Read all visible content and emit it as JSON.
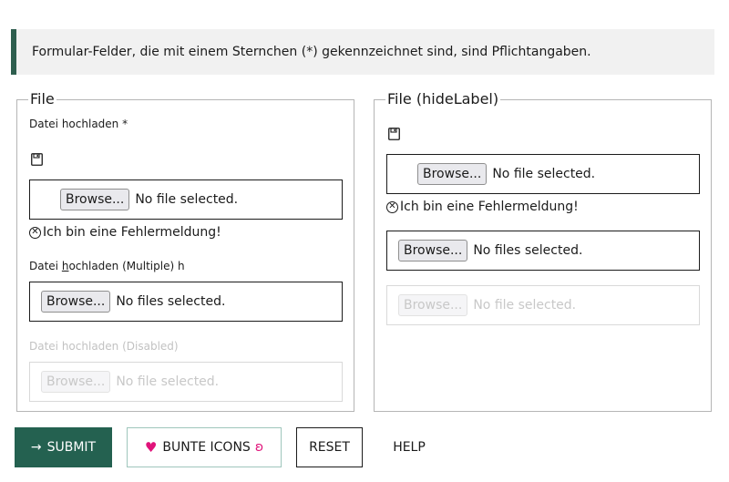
{
  "notice": {
    "text": "Formular-Felder, die mit einem Sternchen (*) gekennzeichnet sind, sind Pflichtangaben."
  },
  "fieldset_left": {
    "legend": "File",
    "field1": {
      "label": "Datei hochladen *",
      "icon": "floppy-disk-icon",
      "button": "Browse...",
      "status": "No file selected.",
      "error": "Ich bin eine Fehlermeldung!"
    },
    "field2": {
      "label_prefix": "Datei ",
      "label_underlined": "h",
      "label_suffix": "ochladen (Multiple) h",
      "button": "Browse...",
      "status": "No files selected."
    },
    "field3": {
      "label": "Datei hochladen (Disabled)",
      "button": "Browse...",
      "status": "No file selected."
    }
  },
  "fieldset_right": {
    "legend": "File (hideLabel)",
    "field1": {
      "icon": "floppy-disk-icon",
      "button": "Browse...",
      "status": "No file selected.",
      "error": "Ich bin eine Fehlermeldung!"
    },
    "field2": {
      "button": "Browse...",
      "status": "No files selected."
    },
    "field3": {
      "button": "Browse...",
      "status": "No file selected."
    }
  },
  "actions": {
    "submit": "SUBMIT",
    "bunte": "BUNTE ICONS",
    "reset": "RESET",
    "help": "HELP"
  },
  "colors": {
    "accent": "#246150",
    "icon_pink": "#e0137a"
  }
}
